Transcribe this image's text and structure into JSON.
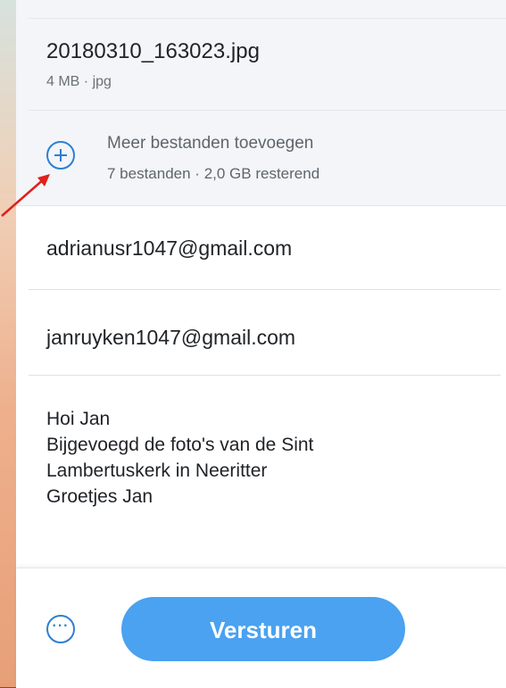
{
  "attachment": {
    "file_name": "20180310_163023.jpg",
    "meta": "4 MB · jpg"
  },
  "add_files": {
    "title": "Meer bestanden toevoegen",
    "subtitle": "7 bestanden · 2,0 GB resterend",
    "icon": "plus-circle-icon"
  },
  "form": {
    "to": "adrianusr1047@gmail.com",
    "from": "janruyken1047@gmail.com",
    "message_lines": [
      "Hoi Jan",
      "Bijgevoegd de foto's van de Sint",
      "Lambertuskerk in Neeritter",
      "Groetjes Jan"
    ]
  },
  "footer": {
    "more_glyph": "···",
    "send_label": "Versturen"
  },
  "colors": {
    "accent": "#2d7fd3",
    "button": "#4aa2f0",
    "annotation_arrow": "#e0201b"
  }
}
